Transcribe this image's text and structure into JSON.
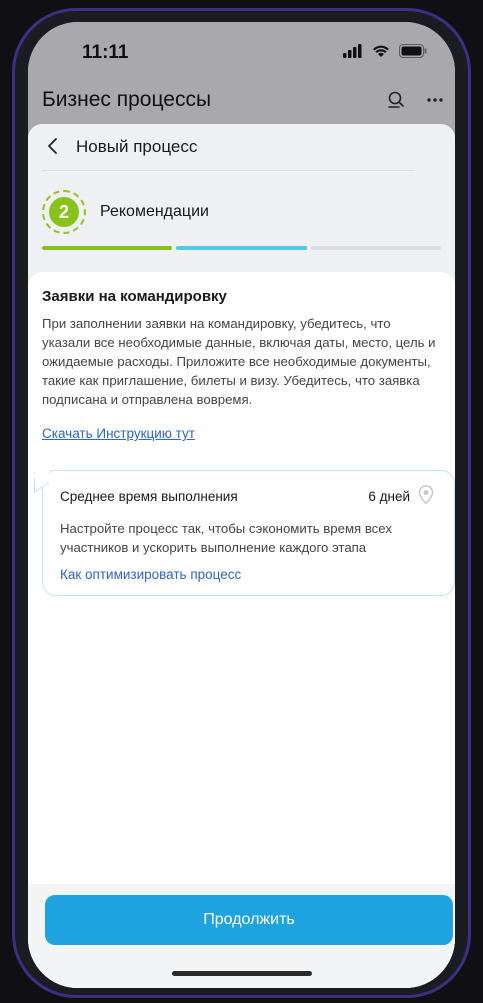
{
  "status_bar": {
    "time": "11:11",
    "icons": [
      "signal-icon",
      "wifi-icon",
      "battery-icon"
    ]
  },
  "header": {
    "title": "Бизнес процессы",
    "icons": [
      "search-list-icon",
      "more-icon"
    ]
  },
  "nav": {
    "title": "Новый процесс",
    "back_icon": "chevron-left-icon"
  },
  "step": {
    "number": "2",
    "label": "Рекомендации",
    "accent": "#88c21a"
  },
  "progress": {
    "colors": [
      "#88c21a",
      "#4fc8e2",
      "#d8dbe0"
    ]
  },
  "content": {
    "title": "Заявки на командировку",
    "body_lines": [
      "При заполнении заявки на командировку, убедитесь, что",
      "указали все необходимые данные, включая даты, место, цель и",
      "ожидаемые расходы. Приложите все необходимые документы,",
      "такие как приглашение, билеты и визу. Убедитесь, что заявка",
      "подписана и отправлена вовремя."
    ],
    "download_link": "Скачать Инструкцию тут"
  },
  "tip": {
    "heading": "Среднее время выполнения",
    "days": "6 дней",
    "pin_icon": "location-pin-icon",
    "text_lines": [
      "Настройте процесс так, чтобы сэкономить время всех",
      "участников и ускорить выполнение каждого этапа"
    ],
    "link": "Как оптимизировать процесс"
  },
  "footer": {
    "button_label": "Продолжить",
    "button_color": "#1fa3e0"
  }
}
